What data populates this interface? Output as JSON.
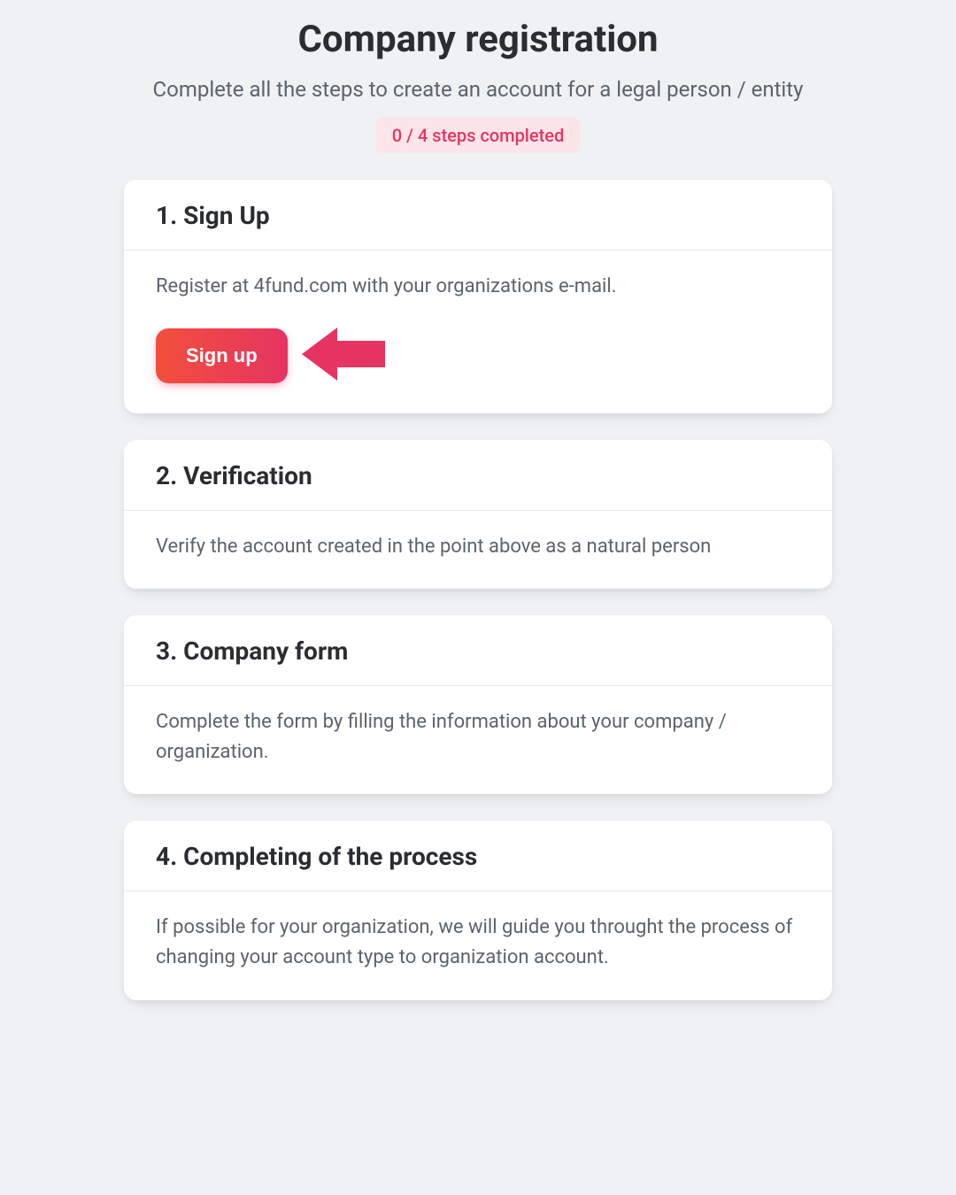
{
  "header": {
    "title": "Company registration",
    "subtitle": "Complete all the steps to create an account for a legal person / entity",
    "progress_badge": "0 / 4 steps completed"
  },
  "steps": [
    {
      "title": "1. Sign Up",
      "body": "Register at 4fund.com with your organizations e-mail.",
      "cta_label": "Sign up"
    },
    {
      "title": "2. Verification",
      "body": "Verify the account created in the point above as a natural person"
    },
    {
      "title": "3. Company form",
      "body": "Complete the form by filling the information about your company / organization."
    },
    {
      "title": "4. Completing of the process",
      "body": "If possible for your organization, we will guide you throught the process of changing your account type to organization account."
    }
  ],
  "colors": {
    "accent_pink": "#e63462",
    "accent_coral": "#f24f3d",
    "badge_bg": "#fbe5e9"
  }
}
